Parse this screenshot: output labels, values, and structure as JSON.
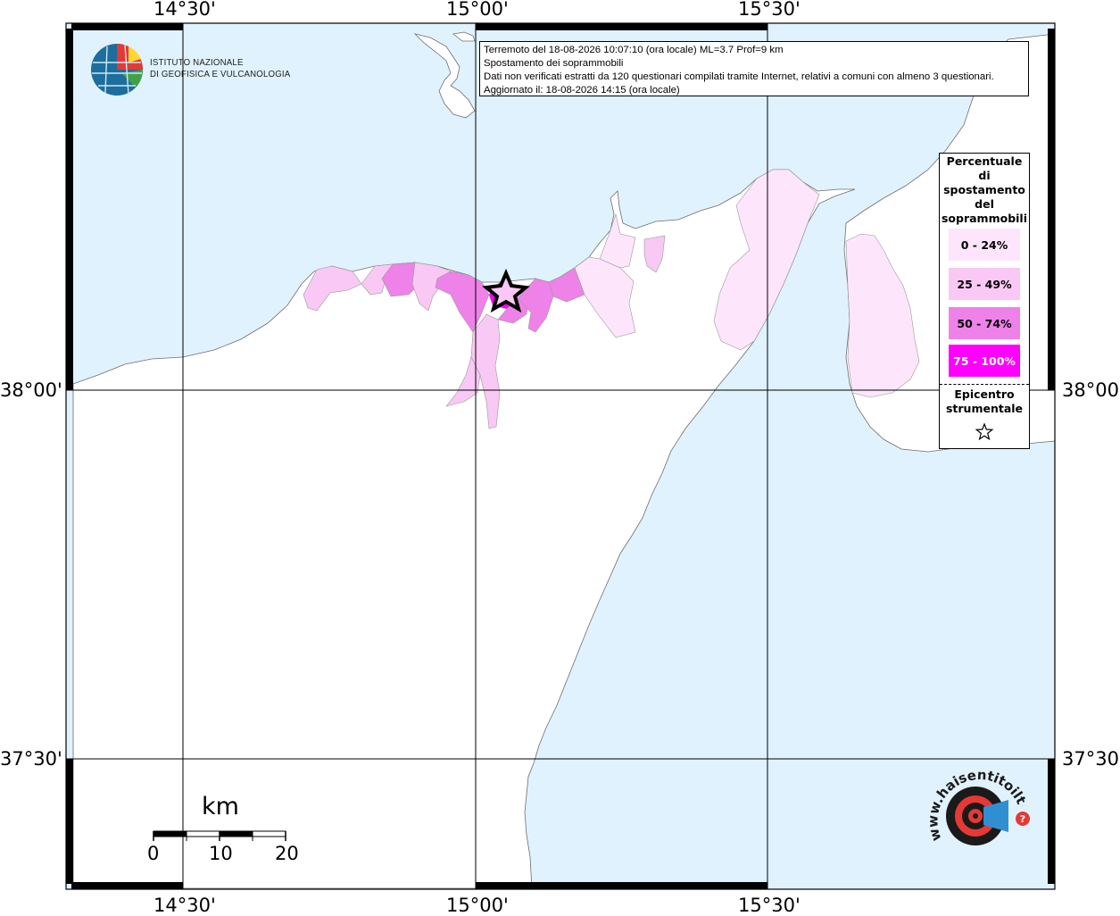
{
  "map": {
    "top_ticks": [
      "14°30'",
      "15°00'",
      "15°30'"
    ],
    "bottom_ticks": [
      "14°30'",
      "15°00'",
      "15°30'"
    ],
    "left_ticks": [
      "38°00'",
      "37°30'"
    ],
    "right_ticks": [
      "38°00'",
      "37°30'"
    ],
    "colors": {
      "sea": "#e0f2fd",
      "land": "#ffffff",
      "class_0_24": "#fde6fb",
      "class_25_49": "#f9c8f4",
      "class_50_74": "#ee82e9",
      "class_75_100": "#ff00ff"
    }
  },
  "info": {
    "line1": "Terremoto del 18-08-2026 10:07:10 (ora locale) ML=3.7 Prof=9 km",
    "line2": "Spostamento dei soprammobili",
    "line3": "Dati non verificati estratti da 120 questionari compilati tramite Internet, relativi a comuni con almeno 3 questionari.",
    "line4": "Aggiornato il: 18-08-2026 14:15 (ora locale)"
  },
  "legend": {
    "title_lines": [
      "Percentuale",
      "di",
      "spostamento",
      "del",
      "soprammobili"
    ],
    "classes": [
      {
        "label": "0 - 24%",
        "color": "#fde6fb",
        "text_color": "#000000"
      },
      {
        "label": "25 - 49%",
        "color": "#f9c8f4",
        "text_color": "#000000"
      },
      {
        "label": "50 - 74%",
        "color": "#ee82e9",
        "text_color": "#000000"
      },
      {
        "label": "75 - 100%",
        "color": "#ff00ff",
        "text_color": "#ffffff"
      }
    ],
    "epicenter_lines": [
      "Epicentro",
      "strumentale"
    ]
  },
  "logos": {
    "ingv_line1": "ISTITUTO NAZIONALE",
    "ingv_line2": "DI GEOFISICA E VULCANOLOGIA",
    "hsit_text": "www.haisentitoilterremoto.it"
  },
  "scale_bar": {
    "unit": "km",
    "labels": [
      "0",
      "10",
      "20"
    ]
  }
}
